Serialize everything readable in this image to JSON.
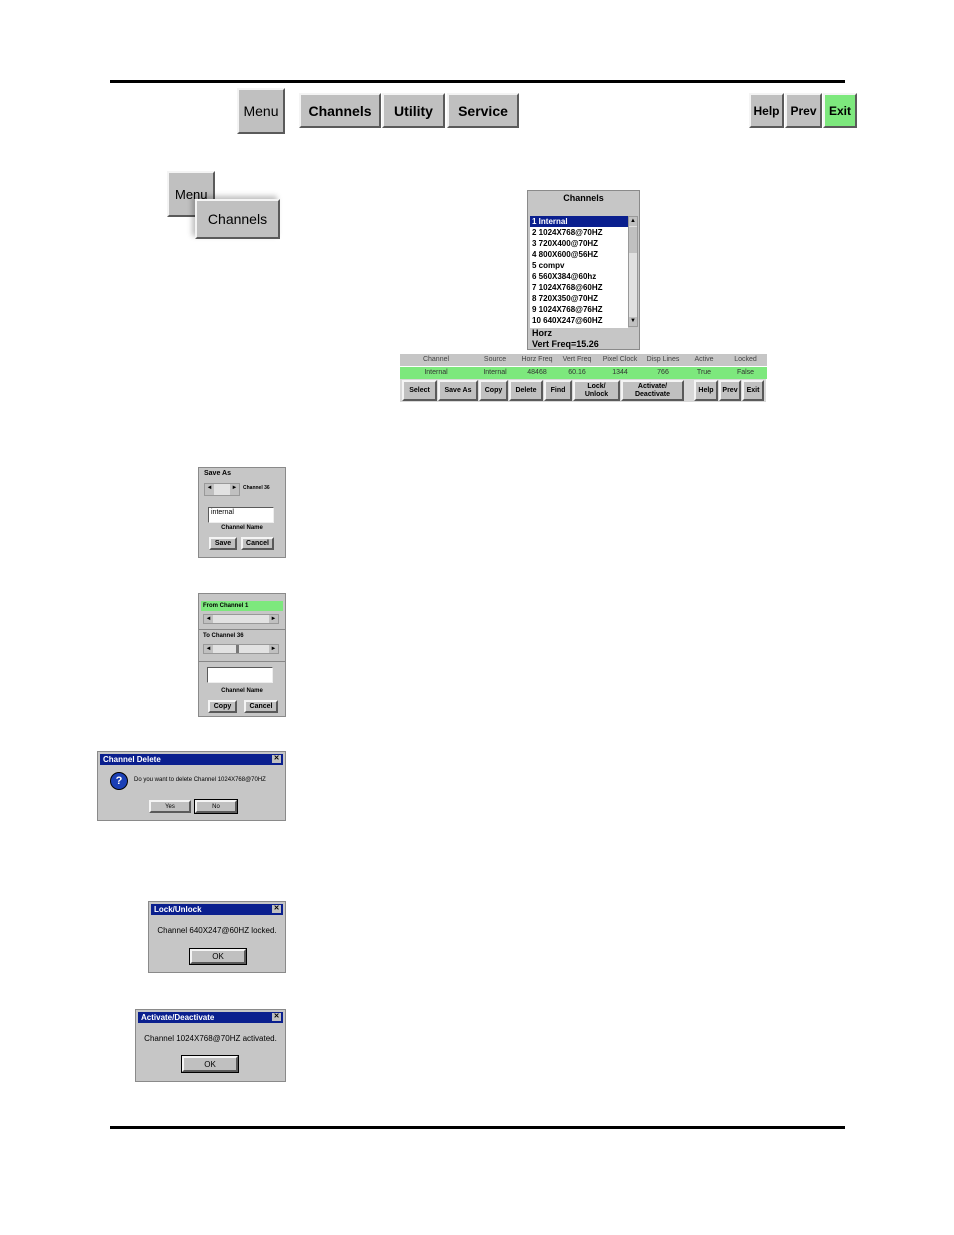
{
  "top_nav": {
    "menu": "Menu",
    "channels": "Channels",
    "utility": "Utility",
    "service": "Service",
    "help": "Help",
    "prev": "Prev",
    "exit": "Exit"
  },
  "path_icon": {
    "menu": "Menu",
    "channels": "Channels"
  },
  "channels_screen": {
    "title": "Channels",
    "list": [
      "1  Internal",
      "2  1024X768@70HZ",
      "3  720X400@70HZ",
      "4  800X600@56HZ",
      "5  compv",
      "6  560X384@60hz",
      "7  1024X768@60HZ",
      "8  720X350@70HZ",
      "9  1024X768@76HZ",
      "10  640X247@60HZ"
    ],
    "horz_label": "Horz",
    "vert_label": "Vert Freq=15.26",
    "headers": [
      "Channel",
      "Source",
      "Horz Freq",
      "Vert Freq",
      "Pixel Clock",
      "Disp Lines",
      "Active",
      "Locked"
    ],
    "values": [
      "Internal",
      "Internal",
      "48468",
      "60.16",
      "1344",
      "766",
      "True",
      "False"
    ],
    "buttons": [
      "Select",
      "Save As",
      "Copy",
      "Delete",
      "Find",
      "Lock/ Unlock",
      "Activate/ Deactivate"
    ],
    "nav": [
      "Help",
      "Prev",
      "Exit"
    ]
  },
  "save_as": {
    "title": "Save As",
    "channel": "Channel 36",
    "input_value": "internal",
    "name_label": "Channel Name",
    "save": "Save",
    "cancel": "Cancel"
  },
  "copy": {
    "from_label": "From Channel 1",
    "to_label": "To Channel 36",
    "name_label": "Channel Name",
    "copy": "Copy",
    "cancel": "Cancel"
  },
  "delete_dialog": {
    "title": "Channel Delete",
    "message": "Do you want to delete Channel 1024X768@70HZ",
    "yes": "Yes",
    "no": "No"
  },
  "lock_dialog": {
    "title": "Lock/Unlock",
    "message": "Channel 640X247@60HZ locked.",
    "ok": "OK"
  },
  "activate_dialog": {
    "title": "Activate/Deactivate",
    "message": "Channel 1024X768@70HZ activated.",
    "ok": "OK"
  }
}
